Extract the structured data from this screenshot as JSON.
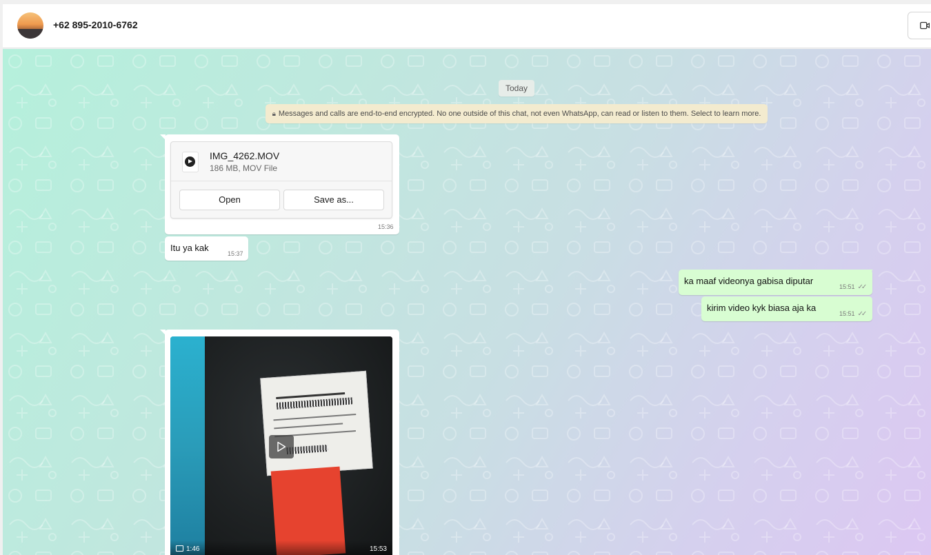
{
  "header": {
    "contact_name": "+62 895-2010-6762"
  },
  "chat": {
    "date_chip": "Today",
    "encryption_notice": "Messages and calls are end-to-end encrypted. No one outside of this chat, not even WhatsApp, can read or listen to them. Select to learn more.",
    "messages": [
      {
        "direction": "incoming",
        "type": "file",
        "file_name": "IMG_4262.MOV",
        "file_meta": "186 MB, MOV File",
        "open_label": "Open",
        "save_label": "Save as...",
        "time": "15:36"
      },
      {
        "direction": "incoming",
        "type": "text",
        "text": "Itu ya kak",
        "time": "15:37"
      },
      {
        "direction": "outgoing",
        "type": "text",
        "text": "ka maaf videonya gabisa diputar",
        "time": "15:51",
        "status": "read"
      },
      {
        "direction": "outgoing",
        "type": "text",
        "text": "kirim video kyk biasa aja ka",
        "time": "15:51",
        "status": "read"
      },
      {
        "direction": "incoming",
        "type": "video",
        "duration": "1:46",
        "time": "15:53"
      }
    ]
  },
  "icons": {
    "video_call": "video-camera-icon",
    "lock": "lock-icon",
    "play": "play-icon",
    "double_check": "double-check-icon"
  },
  "colors": {
    "outgoing_bubble": "#d8fdd2",
    "incoming_bubble": "#ffffff",
    "notice_bg": "#f3ebcf"
  }
}
